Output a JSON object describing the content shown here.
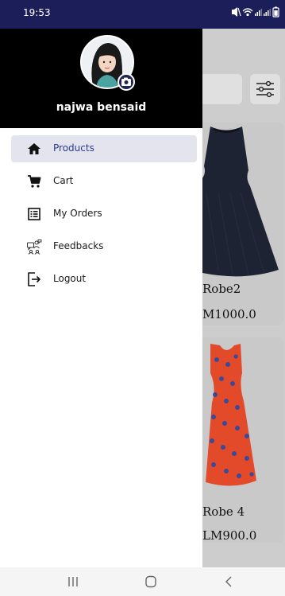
{
  "status_bar": {
    "time": "19:53",
    "icons": [
      "mute-icon",
      "wifi-icon",
      "signal-icon",
      "signal-icon",
      "battery-icon"
    ]
  },
  "drawer": {
    "user_name": "najwa bensaid",
    "menu": [
      {
        "label": "Products",
        "icon": "home-icon",
        "active": true
      },
      {
        "label": "Cart",
        "icon": "cart-icon",
        "active": false
      },
      {
        "label": "My Orders",
        "icon": "orders-list-icon",
        "active": false
      },
      {
        "label": "Feedbacks",
        "icon": "feedback-icon",
        "active": false
      },
      {
        "label": "Logout",
        "icon": "logout-icon",
        "active": false
      }
    ]
  },
  "background": {
    "products": [
      {
        "name": "Robe2",
        "price": "M1000.0"
      },
      {
        "name": "Robe 4",
        "price": "LM900.0"
      }
    ]
  },
  "colors": {
    "status_bar": "#1c1e5a",
    "drawer_header": "#000000",
    "active_item": "#e4e4ef",
    "active_text": "#2b3a8c"
  }
}
